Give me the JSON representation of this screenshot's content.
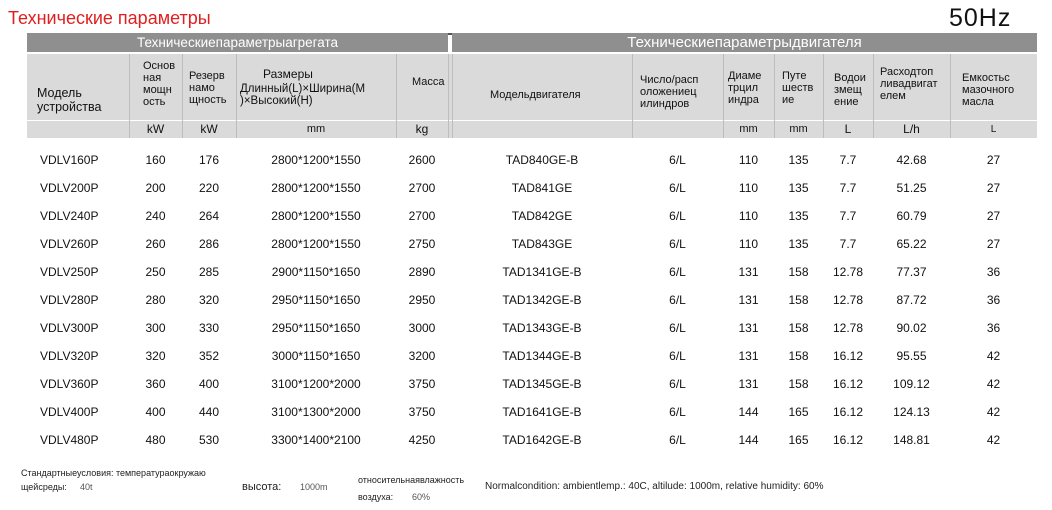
{
  "title": "Технические параметры",
  "hz": "50Hz",
  "sections": {
    "unit": "Техническиепараметрыагрегата",
    "engine": "Техническиепараметрыдвигателя"
  },
  "headers": {
    "model": "Модель устройства",
    "main_power": "Основ ная мощн ость",
    "reserve_power": "Резерв намо щность",
    "dimensions": "Размеры",
    "dimensions_sub": "Длинный(L)×Ширина(M )×Высокий(H)",
    "mass": "Масса",
    "engine_model": "Модельдвигателя",
    "cylinders": "Число/расп оложениец илиндров",
    "bore": "Диаме трцил индра",
    "stroke": "Путе шеств ие",
    "displacement": "Водои змещ ение",
    "fuel": "Расходтоп ливадвигат елем",
    "oil": "Емкостьс мазочного масла"
  },
  "units": {
    "main_power": "kW",
    "reserve_power": "kW",
    "dimensions": "mm",
    "mass": "kg",
    "bore": "mm",
    "stroke": "mm",
    "displacement": "L",
    "fuel": "L/h",
    "oil": "L"
  },
  "rows": [
    {
      "model": "VDLV160P",
      "main": "160",
      "reserve": "176",
      "dims": "2800*1200*1550",
      "mass": "2600",
      "engine": "TAD840GE-B",
      "cyl": "6/L",
      "bore": "110",
      "stroke": "135",
      "disp": "7.7",
      "fuel": "42.68",
      "oil": "27"
    },
    {
      "model": "VDLV200P",
      "main": "200",
      "reserve": "220",
      "dims": "2800*1200*1550",
      "mass": "2700",
      "engine": "TAD841GE",
      "cyl": "6/L",
      "bore": "110",
      "stroke": "135",
      "disp": "7.7",
      "fuel": "51.25",
      "oil": "27"
    },
    {
      "model": "VDLV240P",
      "main": "240",
      "reserve": "264",
      "dims": "2800*1200*1550",
      "mass": "2700",
      "engine": "TAD842GE",
      "cyl": "6/L",
      "bore": "110",
      "stroke": "135",
      "disp": "7.7",
      "fuel": "60.79",
      "oil": "27"
    },
    {
      "model": "VDLV260P",
      "main": "260",
      "reserve": "286",
      "dims": "2800*1200*1550",
      "mass": "2750",
      "engine": "TAD843GE",
      "cyl": "6/L",
      "bore": "110",
      "stroke": "135",
      "disp": "7.7",
      "fuel": "65.22",
      "oil": "27"
    },
    {
      "model": "VDLV250P",
      "main": "250",
      "reserve": "285",
      "dims": "2900*1150*1650",
      "mass": "2890",
      "engine": "TAD1341GE-B",
      "cyl": "6/L",
      "bore": "131",
      "stroke": "158",
      "disp": "12.78",
      "fuel": "77.37",
      "oil": "36"
    },
    {
      "model": "VDLV280P",
      "main": "280",
      "reserve": "320",
      "dims": "2950*1150*1650",
      "mass": "2950",
      "engine": "TAD1342GE-B",
      "cyl": "6/L",
      "bore": "131",
      "stroke": "158",
      "disp": "12.78",
      "fuel": "87.72",
      "oil": "36"
    },
    {
      "model": "VDLV300P",
      "main": "300",
      "reserve": "330",
      "dims": "2950*1150*1650",
      "mass": "3000",
      "engine": "TAD1343GE-B",
      "cyl": "6/L",
      "bore": "131",
      "stroke": "158",
      "disp": "12.78",
      "fuel": "90.02",
      "oil": "36"
    },
    {
      "model": "VDLV320P",
      "main": "320",
      "reserve": "352",
      "dims": "3000*1150*1650",
      "mass": "3200",
      "engine": "TAD1344GE-B",
      "cyl": "6/L",
      "bore": "131",
      "stroke": "158",
      "disp": "16.12",
      "fuel": "95.55",
      "oil": "42"
    },
    {
      "model": "VDLV360P",
      "main": "360",
      "reserve": "400",
      "dims": "3100*1200*2000",
      "mass": "3750",
      "engine": "TAD1345GE-B",
      "cyl": "6/L",
      "bore": "131",
      "stroke": "158",
      "disp": "16.12",
      "fuel": "109.12",
      "oil": "42"
    },
    {
      "model": "VDLV400P",
      "main": "400",
      "reserve": "440",
      "dims": "3100*1300*2000",
      "mass": "3750",
      "engine": "TAD1641GE-B",
      "cyl": "6/L",
      "bore": "144",
      "stroke": "165",
      "disp": "16.12",
      "fuel": "124.13",
      "oil": "42"
    },
    {
      "model": "VDLV480P",
      "main": "480",
      "reserve": "530",
      "dims": "3300*1400*2100",
      "mass": "4250",
      "engine": "TAD1642GE-B",
      "cyl": "6/L",
      "bore": "144",
      "stroke": "165",
      "disp": "16.12",
      "fuel": "148.81",
      "oil": "42"
    }
  ],
  "footer": {
    "std_label_1": "Стандартныеусловия: температураокружаю",
    "std_label_2": "щейсреды:",
    "std_temp": "40t",
    "altitude_label": "высота:",
    "altitude_value": "1000m",
    "humidity_label_1": "относительнаявлажность",
    "humidity_label_2": "воздуха:",
    "humidity_value": "60%",
    "normal_condition": "Normalcondition: ambientlemp.: 40C, altilude: 1000m, relative humidity: 60%"
  }
}
